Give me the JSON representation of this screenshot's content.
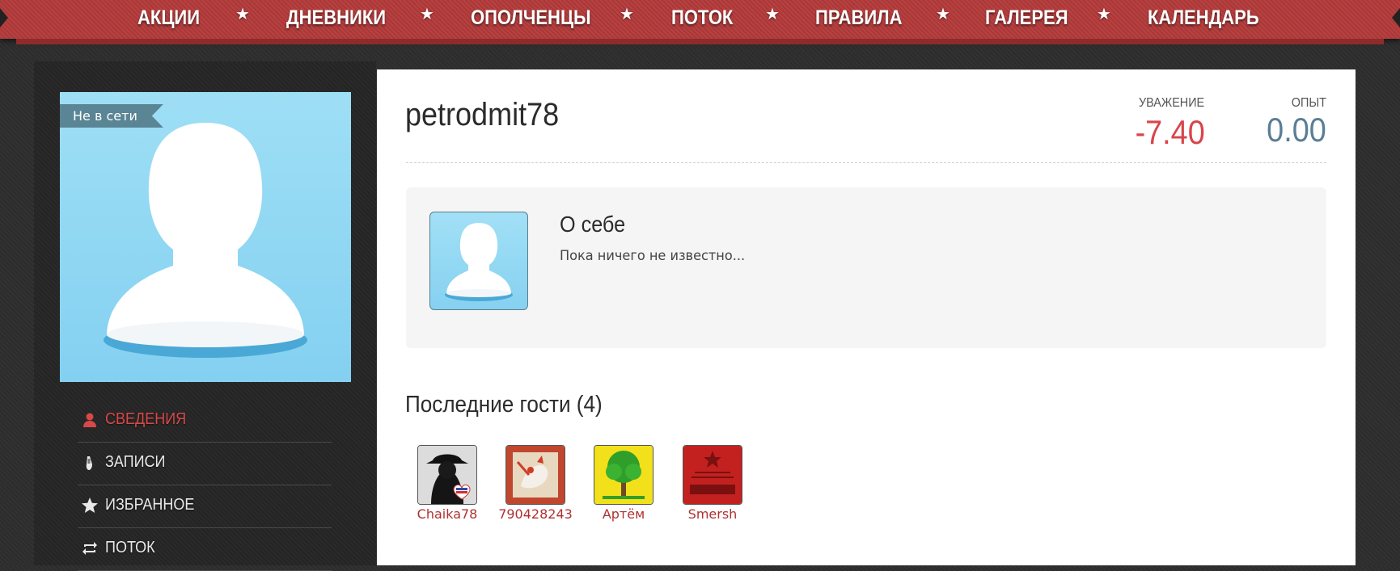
{
  "nav": {
    "items": [
      "АКЦИИ",
      "ДНЕВНИКИ",
      "ОПОЛЧЕНЦЫ",
      "ПОТОК",
      "ПРАВИЛА",
      "ГАЛЕРЕЯ",
      "КАЛЕНДАРЬ"
    ],
    "separator": "★"
  },
  "profile": {
    "status": "Не в сети",
    "username": "petrodmit78",
    "respect_label": "УВАЖЕНИЕ",
    "respect_value": "-7.40",
    "experience_label": "ОПЫТ",
    "experience_value": "0.00"
  },
  "sidebar": {
    "items": [
      {
        "label": "СВЕДЕНИЯ",
        "icon": "user-icon",
        "active": true
      },
      {
        "label": "ЗАПИСИ",
        "icon": "pen-icon",
        "active": false
      },
      {
        "label": "ИЗБРАННОЕ",
        "icon": "star-icon",
        "active": false
      },
      {
        "label": "ПОТОК",
        "icon": "repeat-icon",
        "active": false
      }
    ]
  },
  "about": {
    "title": "О себе",
    "text": "Пока ничего не известно..."
  },
  "guests": {
    "title": "Последние гости (4)",
    "items": [
      {
        "name": "Chaika78"
      },
      {
        "name": "790428243"
      },
      {
        "name": "Артём"
      },
      {
        "name": "Smersh"
      }
    ]
  },
  "colors": {
    "nav_red": "#b53b3b",
    "respect_red": "#d9444b",
    "experience_blue": "#5a7e96",
    "active_menu_red": "#d84848",
    "guest_link_red": "#b03030"
  }
}
